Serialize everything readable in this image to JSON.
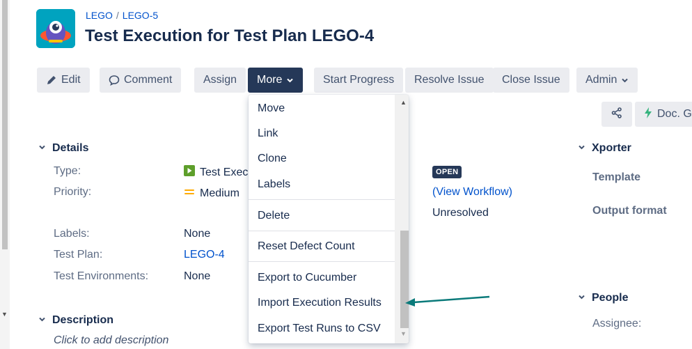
{
  "breadcrumb": {
    "project": "LEGO",
    "separator": "/",
    "issue": "LEGO-5"
  },
  "page_title": "Test Execution for Test Plan LEGO-4",
  "toolbar": {
    "edit": "Edit",
    "comment": "Comment",
    "assign": "Assign",
    "more": "More",
    "start_progress": "Start Progress",
    "resolve_issue": "Resolve Issue",
    "close_issue": "Close Issue",
    "admin": "Admin"
  },
  "secondary_toolbar": {
    "docgen": "Doc. G"
  },
  "more_menu": {
    "items": [
      "Move",
      "Link",
      "Clone",
      "Labels",
      "Delete",
      "Reset Defect Count",
      "Export to Cucumber",
      "Import Execution Results",
      "Export Test Runs to CSV"
    ]
  },
  "details": {
    "heading": "Details",
    "type_label": "Type:",
    "type_value": "Test Execution",
    "priority_label": "Priority:",
    "priority_value": "Medium",
    "labels_label": "Labels:",
    "labels_value": "None",
    "test_plan_label": "Test Plan:",
    "test_plan_value": "LEGO-4",
    "test_env_label": "Test Environments:",
    "test_env_value": "None",
    "status": "OPEN",
    "view_workflow": "(View Workflow)",
    "resolution": "Unresolved"
  },
  "description": {
    "heading": "Description",
    "placeholder": "Click to add description"
  },
  "xporter": {
    "heading": "Xporter",
    "template_label": "Template",
    "output_label": "Output format"
  },
  "people": {
    "heading": "People",
    "assignee_label": "Assignee:"
  },
  "icons": {
    "edit": "pencil-icon",
    "comment": "speech-bubble-icon",
    "dropdown": "chevron-down-icon",
    "share": "share-icon",
    "docgen": "lightning-icon",
    "section_toggle": "chevron-down-icon",
    "type": "test-execution-icon",
    "priority": "priority-medium-icon"
  },
  "colors": {
    "link": "#0052cc",
    "primary_button": "#253858",
    "status_lozenge": "#253858",
    "type_icon": "#5e9f2b",
    "priority_medium": "#ffab00",
    "annotation_arrow": "#0a7a7a"
  }
}
